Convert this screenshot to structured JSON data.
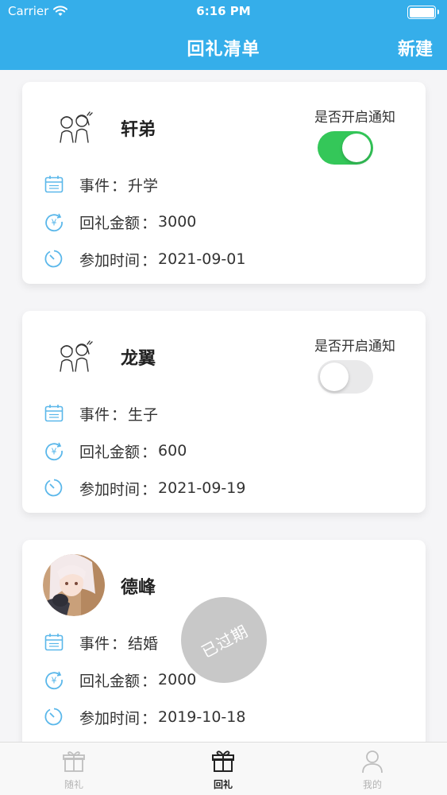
{
  "status_bar": {
    "carrier": "Carrier",
    "time": "6:16 PM"
  },
  "nav": {
    "title": "回礼清单",
    "action": "新建"
  },
  "labels": {
    "notify": "是否开启通知",
    "event": "事件",
    "amount": "回礼金额",
    "date": "参加时间",
    "colon": "："
  },
  "cards": [
    {
      "name": "轩弟",
      "event": "升学",
      "amount": "3000",
      "date": "2021-09-01",
      "notify_on": true,
      "avatar": "couple-sketch-icon"
    },
    {
      "name": "龙翼",
      "event": "生子",
      "amount": "600",
      "date": "2021-09-19",
      "notify_on": false,
      "avatar": "couple-sketch-icon"
    },
    {
      "name": "德峰",
      "event": "结婚",
      "amount": "2000",
      "date": "2019-10-18",
      "expired_badge": "已过期",
      "avatar": "anime-girl-avatar"
    }
  ],
  "tabbar": [
    {
      "label": "随礼",
      "icon": "gift-box-icon",
      "active": false
    },
    {
      "label": "回礼",
      "icon": "gift-icon",
      "active": true
    },
    {
      "label": "我的",
      "icon": "person-icon",
      "active": false
    }
  ],
  "colors": {
    "header": "#35aeea",
    "toggle_on": "#34c759",
    "icon_blue": "#5ab7ea"
  }
}
